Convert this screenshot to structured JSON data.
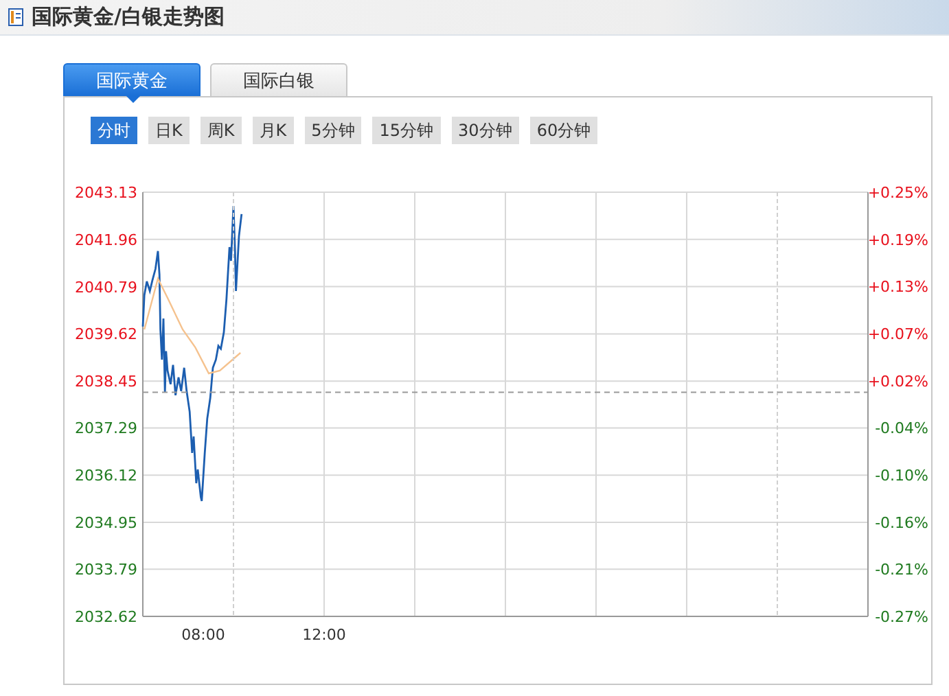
{
  "header": {
    "title": "国际黄金/白银走势图"
  },
  "tabs": [
    {
      "label": "国际黄金",
      "selected": true
    },
    {
      "label": "国际白银",
      "selected": false
    }
  ],
  "periods": [
    {
      "label": "分时",
      "selected": true
    },
    {
      "label": "日K",
      "selected": false
    },
    {
      "label": "周K",
      "selected": false
    },
    {
      "label": "月K",
      "selected": false
    },
    {
      "label": "5分钟",
      "selected": false
    },
    {
      "label": "15分钟",
      "selected": false
    },
    {
      "label": "30分钟",
      "selected": false
    },
    {
      "label": "60分钟",
      "selected": false
    }
  ],
  "right_axis": {
    "labels": [
      {
        "text": "+0.25%",
        "color": "#e8101c"
      },
      {
        "text": "+0.19%",
        "color": "#e8101c"
      },
      {
        "text": "+0.13%",
        "color": "#e8101c"
      },
      {
        "text": "+0.07%",
        "color": "#e8101c"
      },
      {
        "text": "+0.02%",
        "color": "#e8101c"
      },
      {
        "text": "-0.04%",
        "color": "#1f7a1f"
      },
      {
        "text": "-0.10%",
        "color": "#1f7a1f"
      },
      {
        "text": "-0.16%",
        "color": "#1f7a1f"
      },
      {
        "text": "-0.21%",
        "color": "#1f7a1f"
      },
      {
        "text": "-0.27%",
        "color": "#1f7a1f"
      }
    ]
  },
  "chart_data": {
    "type": "line",
    "xlim": [
      6,
      30
    ],
    "ylim": [
      2032.62,
      2043.13
    ],
    "xticks": [
      {
        "value": 8,
        "label": "08:00"
      },
      {
        "value": 12,
        "label": "12:00"
      }
    ],
    "yticks": [
      2043.13,
      2041.96,
      2040.79,
      2039.62,
      2038.45,
      2037.29,
      2036.12,
      2034.95,
      2033.79,
      2032.62
    ],
    "grid": true,
    "series": [
      {
        "color": "#1c5eb0",
        "x": [
          6,
          6.05,
          6.13,
          6.23,
          6.32,
          6.42,
          6.5,
          6.55,
          6.58,
          6.63,
          6.68,
          6.73,
          6.77,
          6.82,
          6.92,
          7,
          7.08,
          7.18,
          7.27,
          7.37,
          7.45,
          7.55,
          7.63,
          7.68,
          7.77,
          7.82,
          7.92,
          7.95,
          8.05,
          8.13,
          8.23,
          8.32,
          8.42,
          8.5,
          8.58,
          8.68,
          8.77,
          8.87,
          8.92,
          9,
          9.05,
          9.08,
          9.18,
          9.27
        ],
        "values": [
          2039.8,
          2040.58,
          2040.92,
          2040.68,
          2040.95,
          2041.23,
          2041.67,
          2041.09,
          2039.73,
          2038.98,
          2040.0,
          2038.17,
          2039.19,
          2038.71,
          2038.37,
          2038.85,
          2038.1,
          2038.54,
          2038.2,
          2038.78,
          2038.2,
          2037.69,
          2036.67,
          2037.08,
          2035.92,
          2036.26,
          2035.58,
          2035.48,
          2036.67,
          2037.52,
          2038.03,
          2038.78,
          2038.98,
          2039.32,
          2039.25,
          2039.66,
          2040.48,
          2041.77,
          2041.43,
          2042.79,
          2041.7,
          2040.68,
          2042.04,
          2042.59
        ]
      },
      {
        "color": "#f5c28e",
        "x": [
          6.05,
          6.5,
          6.82,
          7.32,
          7.73,
          8.18,
          8.55,
          9.23
        ],
        "values": [
          2039.73,
          2040.99,
          2040.51,
          2039.73,
          2039.29,
          2038.64,
          2038.71,
          2039.15
        ]
      }
    ]
  }
}
